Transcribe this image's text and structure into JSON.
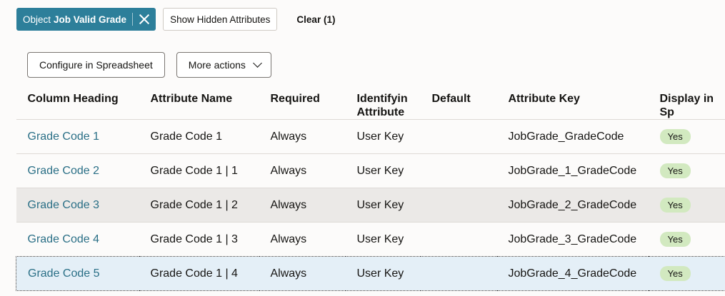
{
  "filter": {
    "chip_prefix": "Object",
    "chip_value": "Job Valid Grade",
    "show_hidden_label": "Show Hidden Attributes",
    "clear_label": "Clear (1)"
  },
  "actions": {
    "configure_label": "Configure in Spreadsheet",
    "more_label": "More actions"
  },
  "table": {
    "headers": [
      "Column Heading",
      "Attribute Name",
      "Required",
      "Identifyin Attribute",
      "Default",
      "Attribute Key",
      "Display in Sp"
    ],
    "rows": [
      {
        "heading": "Grade Code 1",
        "name": "Grade Code 1",
        "required": "Always",
        "identifying": "User Key",
        "default": "",
        "key": "JobGrade_GradeCode",
        "display": "Yes"
      },
      {
        "heading": "Grade Code 2",
        "name": "Grade Code 1 | 1",
        "required": "Always",
        "identifying": "User Key",
        "default": "",
        "key": "JobGrade_1_GradeCode",
        "display": "Yes"
      },
      {
        "heading": "Grade Code 3",
        "name": "Grade Code 1 | 2",
        "required": "Always",
        "identifying": "User Key",
        "default": "",
        "key": "JobGrade_2_GradeCode",
        "display": "Yes"
      },
      {
        "heading": "Grade Code 4",
        "name": "Grade Code 1 | 3",
        "required": "Always",
        "identifying": "User Key",
        "default": "",
        "key": "JobGrade_3_GradeCode",
        "display": "Yes"
      },
      {
        "heading": "Grade Code 5",
        "name": "Grade Code 1 | 4",
        "required": "Always",
        "identifying": "User Key",
        "default": "",
        "key": "JobGrade_4_GradeCode",
        "display": "Yes"
      }
    ]
  }
}
